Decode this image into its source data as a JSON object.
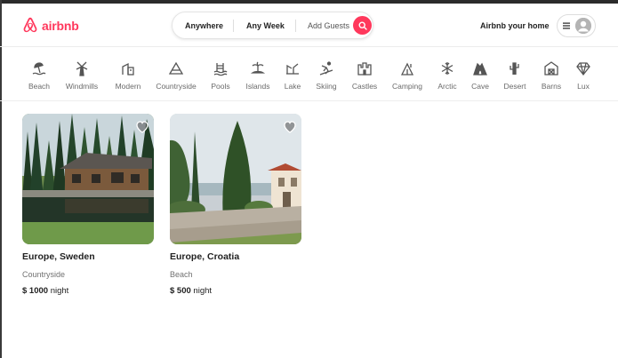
{
  "brand": {
    "name": "airbnb",
    "color": "#ff385c"
  },
  "search": {
    "anywhere": "Anywhere",
    "week": "Any Week",
    "guests": "Add Guests"
  },
  "header": {
    "host_label": "Airbnb your home"
  },
  "categories": [
    {
      "label": "Beach",
      "icon": "beach-icon"
    },
    {
      "label": "Windmills",
      "icon": "windmill-icon"
    },
    {
      "label": "Modern",
      "icon": "modern-icon"
    },
    {
      "label": "Countryside",
      "icon": "countryside-icon"
    },
    {
      "label": "Pools",
      "icon": "pool-icon"
    },
    {
      "label": "Islands",
      "icon": "island-icon"
    },
    {
      "label": "Lake",
      "icon": "lake-icon"
    },
    {
      "label": "Skiing",
      "icon": "skiing-icon"
    },
    {
      "label": "Castles",
      "icon": "castle-icon"
    },
    {
      "label": "Camping",
      "icon": "camping-icon"
    },
    {
      "label": "Arctic",
      "icon": "snowflake-icon"
    },
    {
      "label": "Cave",
      "icon": "cave-icon"
    },
    {
      "label": "Desert",
      "icon": "cactus-icon"
    },
    {
      "label": "Barns",
      "icon": "barn-icon"
    },
    {
      "label": "Lux",
      "icon": "diamond-icon"
    }
  ],
  "listings": [
    {
      "title": "Europe, Sweden",
      "category": "Countryside",
      "price": "$ 1000",
      "unit": "night"
    },
    {
      "title": "Europe, Croatia",
      "category": "Beach",
      "price": "$ 500",
      "unit": "night"
    }
  ]
}
